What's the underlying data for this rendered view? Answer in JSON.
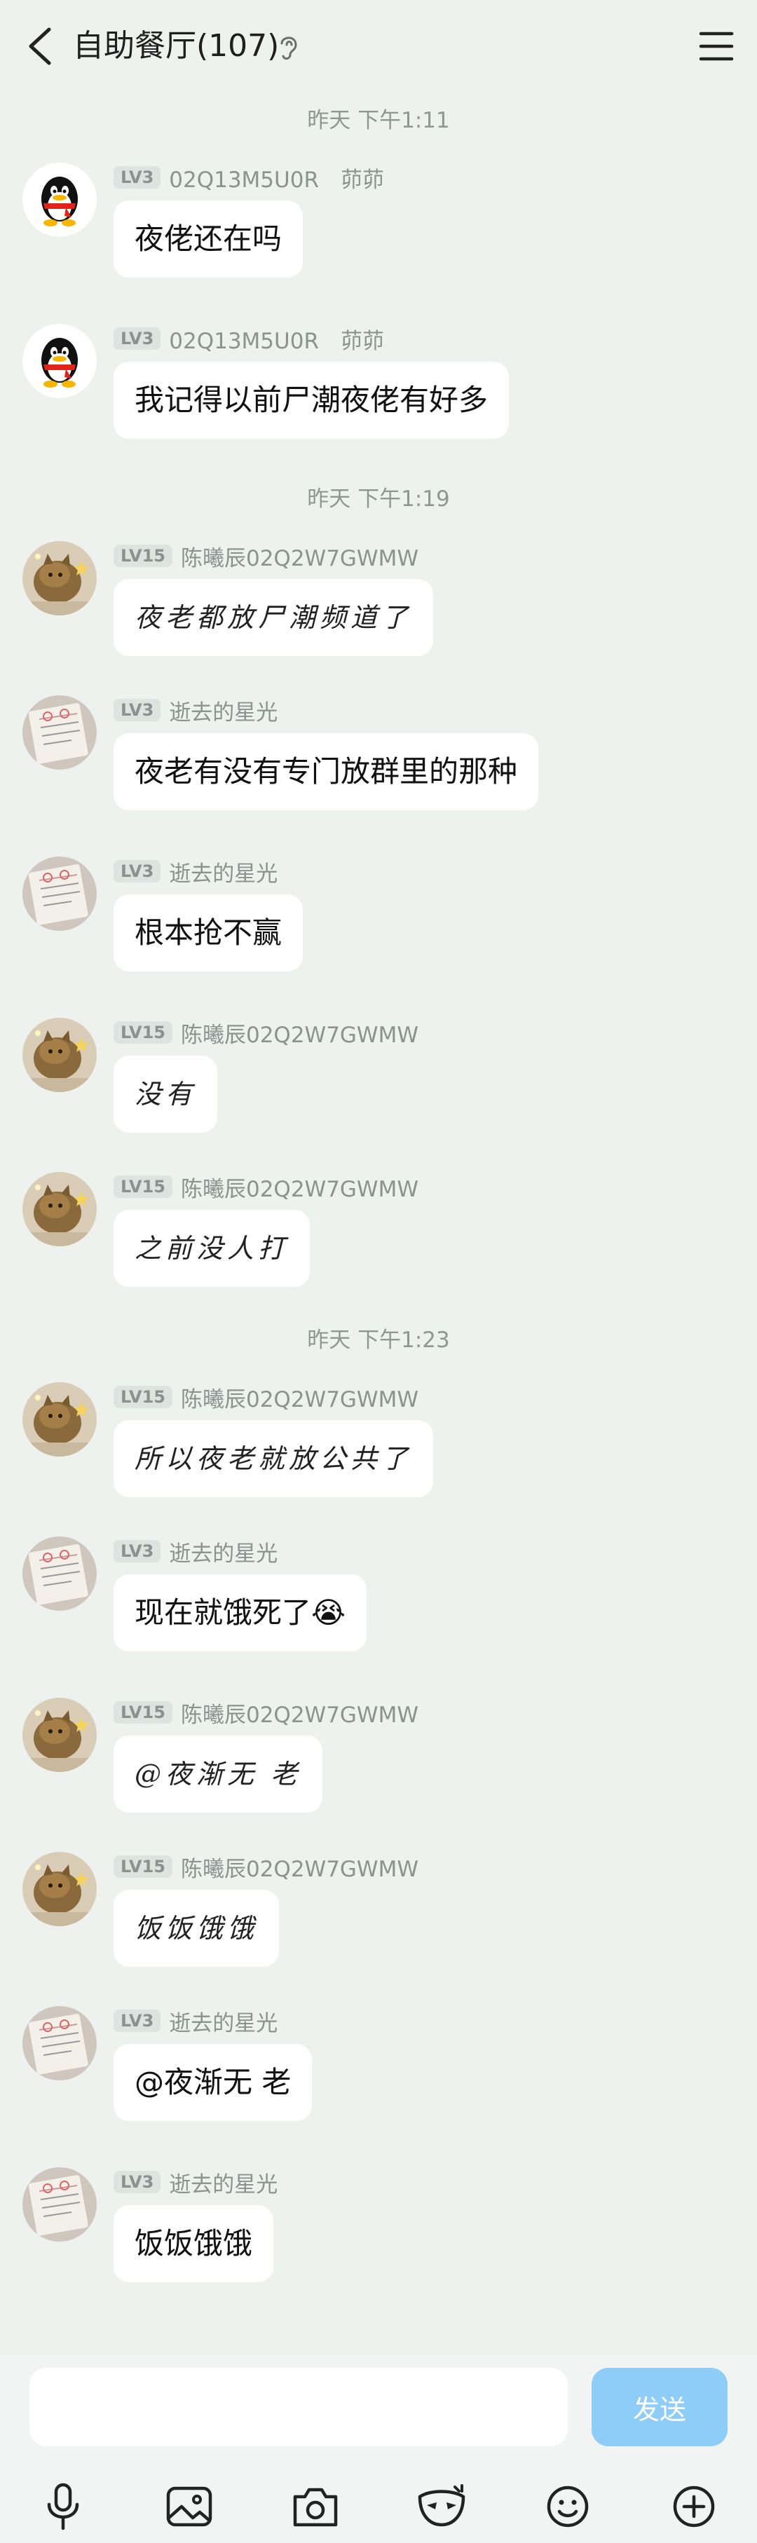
{
  "header": {
    "title": "自助餐厅(107)"
  },
  "messages": [
    {
      "type": "time",
      "text": "昨天 下午1:11"
    },
    {
      "type": "msg",
      "avatar": "qq-penguin",
      "level": "LV3",
      "sender": "02Q13M5U0R　茆茆",
      "text": "夜佬还在吗",
      "style": "normal"
    },
    {
      "type": "msg",
      "avatar": "qq-penguin",
      "level": "LV3",
      "sender": "02Q13M5U0R　茆茆",
      "text": "我记得以前尸潮夜佬有好多",
      "style": "normal"
    },
    {
      "type": "time",
      "text": "昨天 下午1:19"
    },
    {
      "type": "msg",
      "avatar": "cat-photo",
      "level": "LV15",
      "sender": "陈曦辰02Q2W7GWMW",
      "text": "夜老都放尸潮频道了",
      "style": "hand"
    },
    {
      "type": "msg",
      "avatar": "paper-photo",
      "level": "LV3",
      "sender": "逝去的星光",
      "text": "夜老有没有专门放群里的那种",
      "style": "normal"
    },
    {
      "type": "msg",
      "avatar": "paper-photo",
      "level": "LV3",
      "sender": "逝去的星光",
      "text": "根本抢不赢",
      "style": "normal"
    },
    {
      "type": "msg",
      "avatar": "cat-photo",
      "level": "LV15",
      "sender": "陈曦辰02Q2W7GWMW",
      "text": "没有",
      "style": "hand"
    },
    {
      "type": "msg",
      "avatar": "cat-photo",
      "level": "LV15",
      "sender": "陈曦辰02Q2W7GWMW",
      "text": "之前没人打",
      "style": "hand"
    },
    {
      "type": "time",
      "text": "昨天 下午1:23"
    },
    {
      "type": "msg",
      "avatar": "cat-photo",
      "level": "LV15",
      "sender": "陈曦辰02Q2W7GWMW",
      "text": "所以夜老就放公共了",
      "style": "hand"
    },
    {
      "type": "msg",
      "avatar": "paper-photo",
      "level": "LV3",
      "sender": "逝去的星光",
      "text": "现在就饿死了😭",
      "style": "normal"
    },
    {
      "type": "msg",
      "avatar": "cat-photo",
      "level": "LV15",
      "sender": "陈曦辰02Q2W7GWMW",
      "text": "@夜渐无 老",
      "style": "hand"
    },
    {
      "type": "msg",
      "avatar": "cat-photo",
      "level": "LV15",
      "sender": "陈曦辰02Q2W7GWMW",
      "text": "饭饭饿饿",
      "style": "hand"
    },
    {
      "type": "msg",
      "avatar": "paper-photo",
      "level": "LV3",
      "sender": "逝去的星光",
      "text": "@夜渐无 老",
      "style": "normal"
    },
    {
      "type": "msg",
      "avatar": "paper-photo",
      "level": "LV3",
      "sender": "逝去的星光",
      "text": "饭饭饿饿",
      "style": "normal"
    }
  ],
  "composer": {
    "input_value": "",
    "send_label": "发送"
  },
  "toolbar_icons": [
    "microphone-icon",
    "image-icon",
    "camera-icon",
    "mask-icon",
    "emoji-icon",
    "plus-icon"
  ],
  "colors": {
    "background": "#edf2ef",
    "bubble": "#ffffff",
    "send_button": "#8ecdf7",
    "level_badge": "#dde3e0"
  }
}
